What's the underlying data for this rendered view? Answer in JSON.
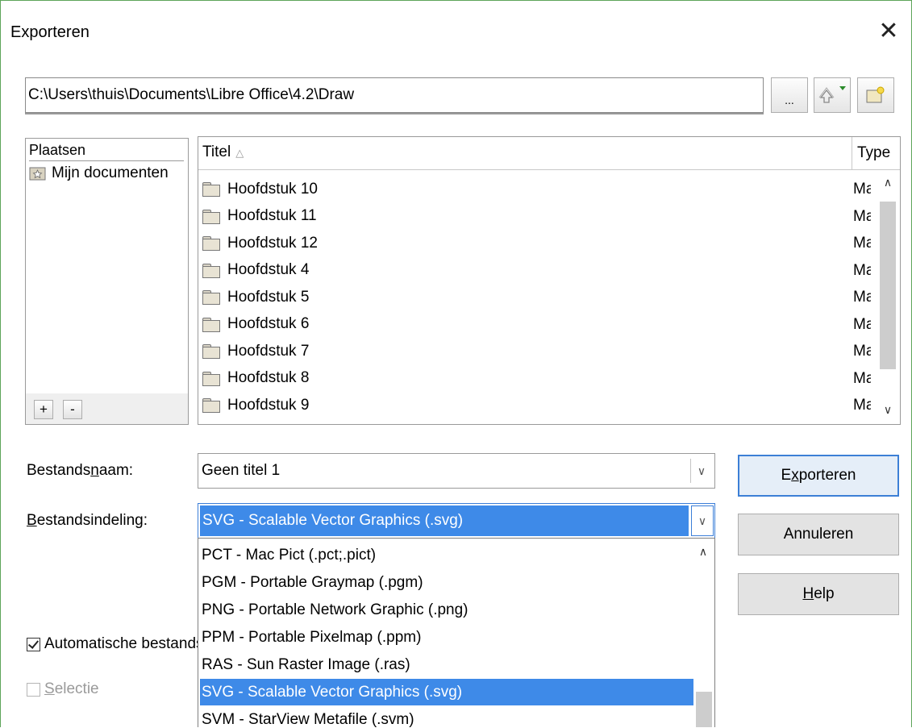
{
  "window": {
    "title": "Exporteren",
    "close_label": "✕"
  },
  "path": {
    "value": "C:\\Users\\thuis\\Documents\\Libre Office\\4.2\\Draw",
    "browse_label": "..."
  },
  "places": {
    "header": "Plaatsen",
    "items": [
      {
        "label": "Mijn documenten"
      }
    ],
    "add_label": "+",
    "remove_label": "-"
  },
  "files": {
    "col_title": "Titel",
    "sort_indicator": "△",
    "col_type": "Type",
    "rows": [
      {
        "name": "Hoofdstuk 10",
        "type": "Map"
      },
      {
        "name": "Hoofdstuk 11",
        "type": "Map"
      },
      {
        "name": "Hoofdstuk 12",
        "type": "Map"
      },
      {
        "name": "Hoofdstuk 4",
        "type": "Map"
      },
      {
        "name": "Hoofdstuk 5",
        "type": "Map"
      },
      {
        "name": "Hoofdstuk 6",
        "type": "Map"
      },
      {
        "name": "Hoofdstuk 7",
        "type": "Map"
      },
      {
        "name": "Hoofdstuk 8",
        "type": "Map"
      },
      {
        "name": "Hoofdstuk 9",
        "type": "Map"
      }
    ]
  },
  "form": {
    "filename_label_pre": "Bestands",
    "filename_label_u": "n",
    "filename_label_post": "aam:",
    "filename_value": "Geen titel 1",
    "format_label_u": "B",
    "format_label_post": "estandsindeling:",
    "format_value": "SVG - Scalable Vector Graphics (.svg)"
  },
  "buttons": {
    "export_pre": "E",
    "export_u": "x",
    "export_post": "porteren",
    "cancel": "Annuleren",
    "help_u": "H",
    "help_post": "elp"
  },
  "format_options": [
    "PCT - Mac Pict (.pct;.pict)",
    "PGM - Portable Graymap (.pgm)",
    "PNG - Portable Network Graphic (.png)",
    "PPM - Portable Pixelmap (.ppm)",
    "RAS - Sun Raster Image (.ras)",
    "SVG - Scalable Vector Graphics (.svg)",
    "SVM - StarView Metafile (.svm)"
  ],
  "options": {
    "auto_ext_label": "Automatische bestandsnaamextensie",
    "auto_ext_checked": true,
    "selection_label_u": "S",
    "selection_label_post": "electie",
    "selection_checked": false
  },
  "colors": {
    "selection": "#3e8ae8",
    "default_button_border": "#3c7fd6",
    "window_border": "#5ea45a"
  }
}
